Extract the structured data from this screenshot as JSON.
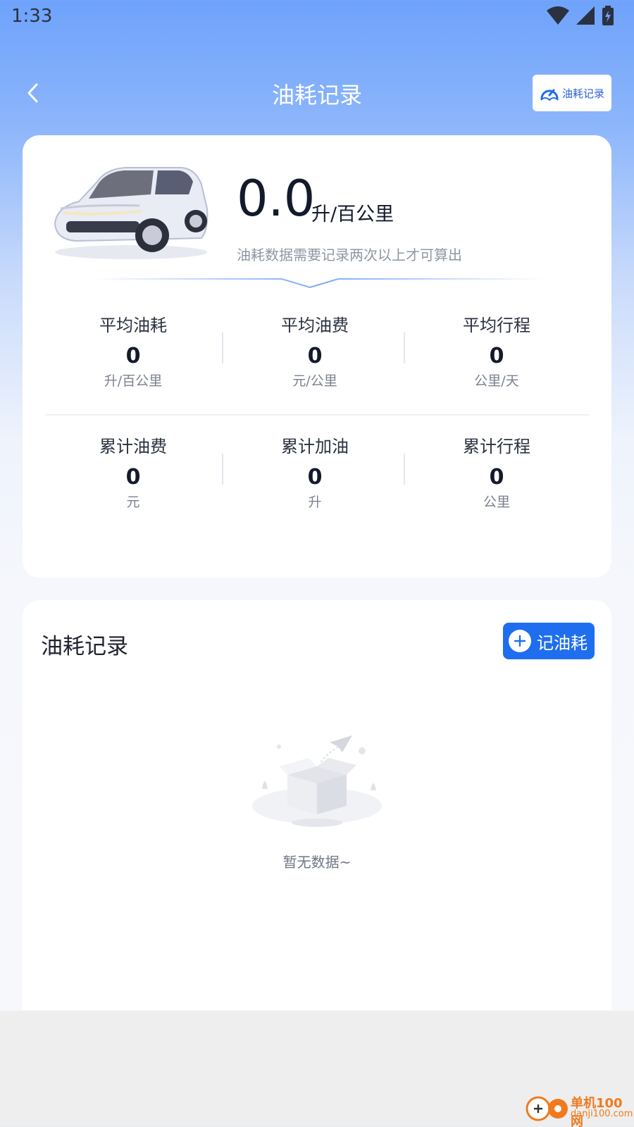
{
  "status_bar": {
    "time": "1:33"
  },
  "nav": {
    "title": "油耗记录",
    "action_label": "油耗记录"
  },
  "summary": {
    "value": "0.0",
    "unit": "升/百公里",
    "hint": "油耗数据需要记录两次以上才可算出"
  },
  "stats": {
    "row1": [
      {
        "label": "平均油耗",
        "value": "0",
        "unit": "升/百公里"
      },
      {
        "label": "平均油费",
        "value": "0",
        "unit": "元/公里"
      },
      {
        "label": "平均行程",
        "value": "0",
        "unit": "公里/天"
      }
    ],
    "row2": [
      {
        "label": "累计油费",
        "value": "0",
        "unit": "元"
      },
      {
        "label": "累计加油",
        "value": "0",
        "unit": "升"
      },
      {
        "label": "累计行程",
        "value": "0",
        "unit": "公里"
      }
    ]
  },
  "records": {
    "title": "油耗记录",
    "add_label": "记油耗",
    "empty_text": "暂无数据~"
  },
  "watermark": {
    "line1": "单机100网",
    "line2": "danji100.com"
  },
  "colors": {
    "accent": "#1f6ef0",
    "header_top": "#6ea2fb"
  }
}
